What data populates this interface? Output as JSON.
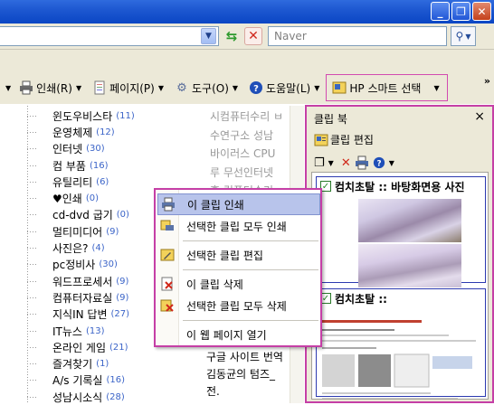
{
  "window": {
    "minimize_icon": "minimize-icon",
    "maximize_icon": "restore-icon",
    "close_icon": "close-icon"
  },
  "address": {
    "search_placeholder": "Naver"
  },
  "toolbar": {
    "print_label": "인쇄(R)",
    "page_label": "페이지(P)",
    "tools_label": "도구(O)",
    "help_label": "도움말(L)",
    "hp_label": "HP 스마트 선택",
    "overflow": "»"
  },
  "categories": [
    {
      "name": "윈도우비스타",
      "count": "(11)"
    },
    {
      "name": "운영체제",
      "count": "(12)"
    },
    {
      "name": "인터넷",
      "count": "(30)"
    },
    {
      "name": "컴 부품",
      "count": "(16)"
    },
    {
      "name": "유틸리티",
      "count": "(6)"
    },
    {
      "name": "♥인쇄",
      "count": "(0)"
    },
    {
      "name": "cd-dvd 굽기",
      "count": "(0)"
    },
    {
      "name": "멀티미디어",
      "count": "(9)"
    },
    {
      "name": "사진은?",
      "count": "(4)"
    },
    {
      "name": "pc정비사",
      "count": "(30)"
    },
    {
      "name": "워드프로세서",
      "count": "(9)"
    },
    {
      "name": "컴퓨터자료실",
      "count": "(9)"
    },
    {
      "name": "지식IN 답변",
      "count": "(27)"
    },
    {
      "name": "IT뉴스",
      "count": "(13)"
    },
    {
      "name": "온라인 게임",
      "count": "(21)"
    },
    {
      "name": "즐겨찾기",
      "count": "(1)"
    },
    {
      "name": "A/s 기록실",
      "count": "(16)"
    },
    {
      "name": "성남시소식",
      "count": "(28)"
    }
  ],
  "side_text": [
    "시컴퓨터수리 ㅂ",
    "수연구소 성남",
    "바이러스 CPU",
    "루 무선인터넷",
    "홍 컴퓨터수리"
  ],
  "bottom_text": [
    "구글 사이트 번역",
    "김동균의 텀즈_",
    "전."
  ],
  "clipbook": {
    "title": "클립 북",
    "close": "×",
    "edit_label": "클립 편집",
    "clips": [
      {
        "title": "컴치초탈 :: 바탕화면용 사진"
      },
      {
        "title": "컴치초탈 ::"
      }
    ]
  },
  "context_menu": [
    {
      "label": "이 클립 인쇄"
    },
    {
      "label": "선택한 클립 모두 인쇄"
    },
    {
      "label": "선택한 클립 편집"
    },
    {
      "label": "이 클립 삭제"
    },
    {
      "label": "선택한 클립 모두 삭제"
    },
    {
      "label": "이 웹 페이지 열기"
    }
  ]
}
